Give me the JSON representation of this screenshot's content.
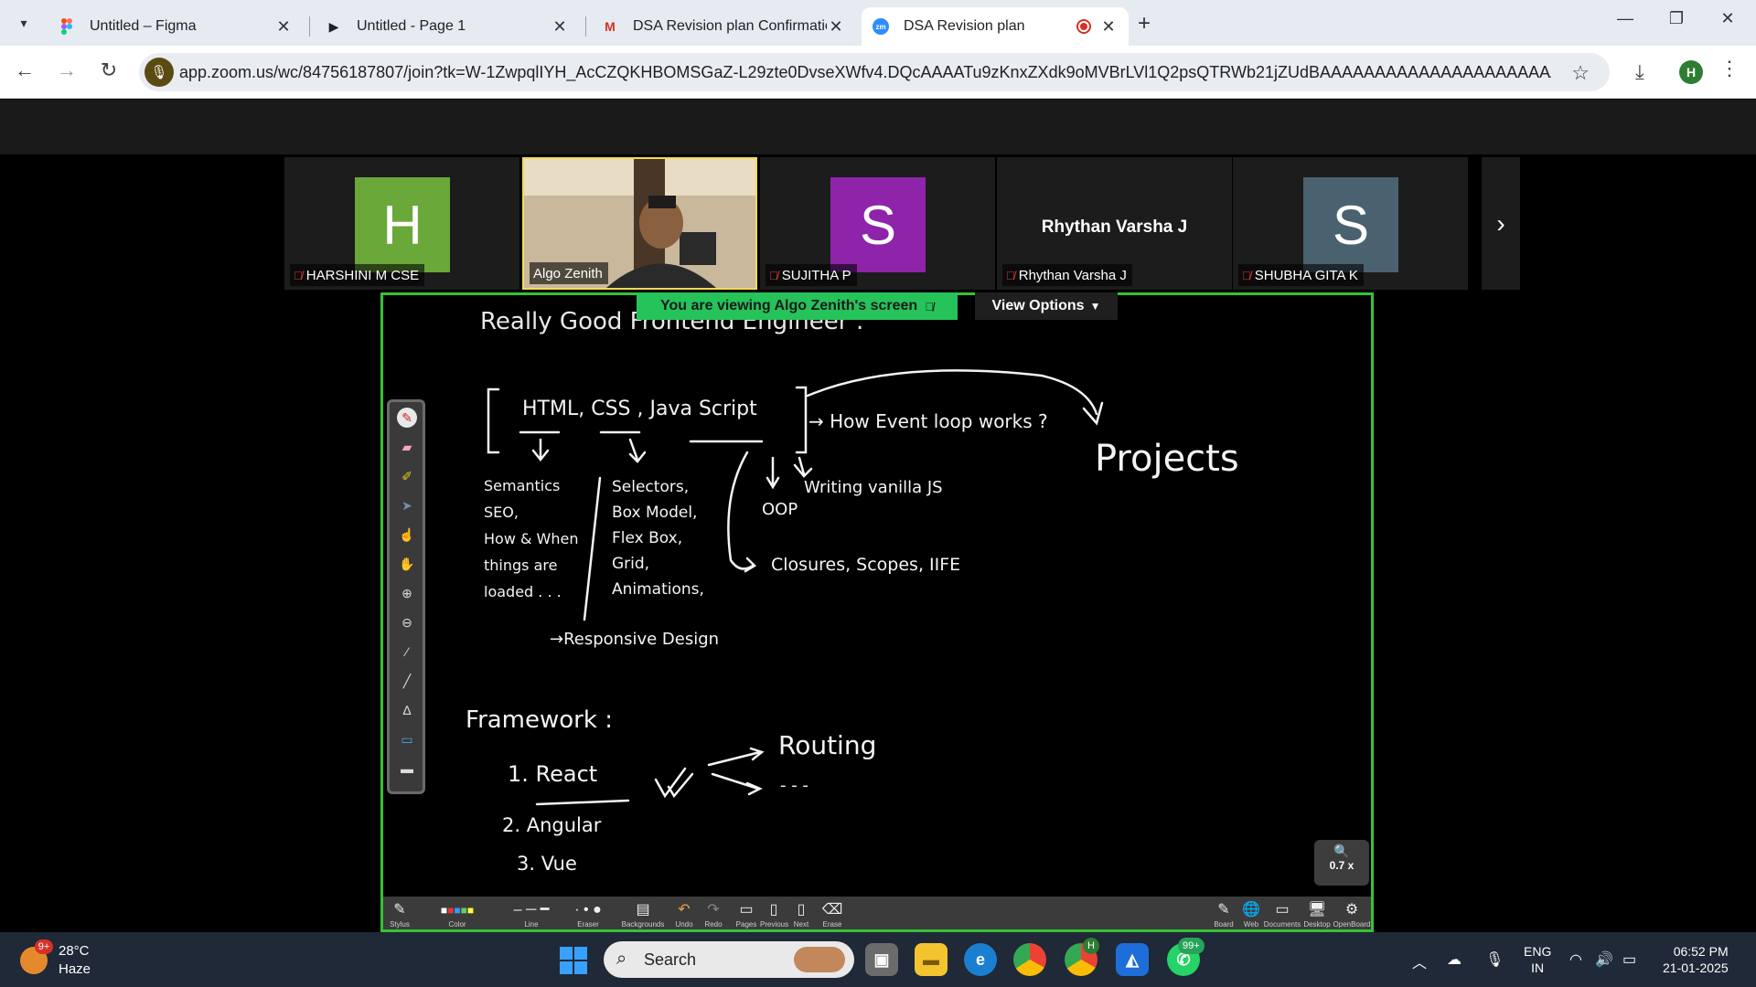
{
  "browser": {
    "tabs": [
      {
        "title": "Untitled – Figma",
        "icon": "figma-icon"
      },
      {
        "title": "Untitled - Page 1",
        "icon": "play-icon"
      },
      {
        "title": "DSA Revision plan Confirmation",
        "icon": "gmail-icon"
      },
      {
        "title": "DSA Revision plan",
        "icon": "zoom-icon",
        "active": true
      }
    ],
    "url": "app.zoom.us/wc/84756187807/join?tk=W-1ZwpqlIYH_AcCZQKHBOMSGaZ-L29zte0DvseXWfv4.DQcAAAATu9zKnxZXdk9oMVBrLVl1Q2psQTRWb21jZUdBAAAAAAAAAAAAAAAAAAAAAAAAAAAAAAA...",
    "profile_initial": "H"
  },
  "participants": [
    {
      "name": "HARSHINI M CSE",
      "initial": "H",
      "color": "#6aa83a",
      "muted": true
    },
    {
      "name": "Algo Zenith",
      "video": true,
      "muted": false
    },
    {
      "name": "SUJITHA P",
      "initial": "S",
      "color": "#8e24aa",
      "muted": true
    },
    {
      "name": "Rhythan Varsha J",
      "display": "Rhythan Varsha J",
      "muted": true
    },
    {
      "name": "SHUBHA GITA K",
      "initial": "S",
      "color": "#4a6170",
      "muted": true
    }
  ],
  "share": {
    "banner": "You are viewing  Algo Zenith's screen",
    "view_options": "View Options",
    "zoom_level": "0.7 x"
  },
  "whiteboard": {
    "title": "Really Good Frontend Engineer :",
    "brace_items": "HTML,  CSS  , Java Script",
    "event_loop": "→ How Event loop works ?",
    "projects": "Projects",
    "html_notes": [
      "Semantics",
      "SEO,",
      "How & When",
      "things are",
      "loaded . . ."
    ],
    "css_notes": [
      "Selectors,",
      "Box Model,",
      "Flex Box,",
      "Grid,",
      "Animations,"
    ],
    "responsive": "→Responsive Design",
    "js_oop": "OOP",
    "js_vanilla": "Writing vanilla JS",
    "js_closures": "Closures, Scopes, IIFE",
    "frameworks_title": "Framework :",
    "frameworks": [
      "1. React",
      "2. Angular",
      "3. Vue"
    ],
    "routing": "Routing",
    "routing_more": "- - -"
  },
  "board_toolbar": [
    "Stylus",
    "Color",
    "Line",
    "Eraser",
    "Backgrounds",
    "Undo",
    "Redo",
    "Pages",
    "Previous",
    "Next",
    "Erase",
    "Board",
    "Web",
    "Documents",
    "Desktop",
    "OpenBoard"
  ],
  "taskbar": {
    "weather_badge": "9+",
    "temperature": "28°C",
    "condition": "Haze",
    "search": "Search",
    "whatsapp_badge": "99+",
    "chrome_badge": "H",
    "lang_top": "ENG",
    "lang_bottom": "IN",
    "time": "06:52 PM",
    "date": "21-01-2025"
  },
  "colors": {
    "share_border": "#35c235",
    "banner_bg": "#25c35a",
    "title_red": "#e53935",
    "title_blue": "#3f7be0"
  }
}
